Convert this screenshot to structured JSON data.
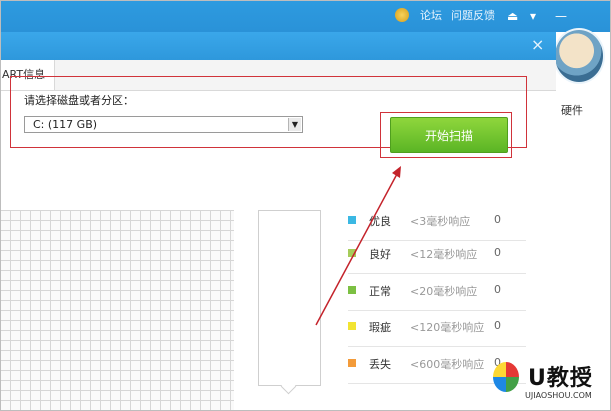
{
  "topbar": {
    "forum_label": "论坛",
    "feedback_label": "问题反馈",
    "icons": [
      "medal-icon",
      "skin-icon",
      "menu-icon",
      "minimize-icon"
    ]
  },
  "side": {
    "text": "硬件"
  },
  "dialog": {
    "close_glyph": "×",
    "tab_label": "ART信息",
    "drive_label": "请选择磁盘或者分区：",
    "drive_value": "C:  (117 GB)",
    "scan_button": "开始扫描"
  },
  "legend": [
    {
      "name": "优良",
      "range": "<3毫秒响应",
      "count": "0",
      "color": "#3bb8e3"
    },
    {
      "name": "良好",
      "range": "<12毫秒响应",
      "count": "0",
      "color": "#a6cc5a"
    },
    {
      "name": "正常",
      "range": "<20毫秒响应",
      "count": "0",
      "color": "#7cc043"
    },
    {
      "name": "瑕疵",
      "range": "<120毫秒响应",
      "count": "0",
      "color": "#f2e432"
    },
    {
      "name": "丢失",
      "range": "<600毫秒响应",
      "count": "0",
      "color": "#f39b3a"
    }
  ],
  "brand": {
    "name": "U教授",
    "url": "UJIAOSHOU.COM"
  }
}
